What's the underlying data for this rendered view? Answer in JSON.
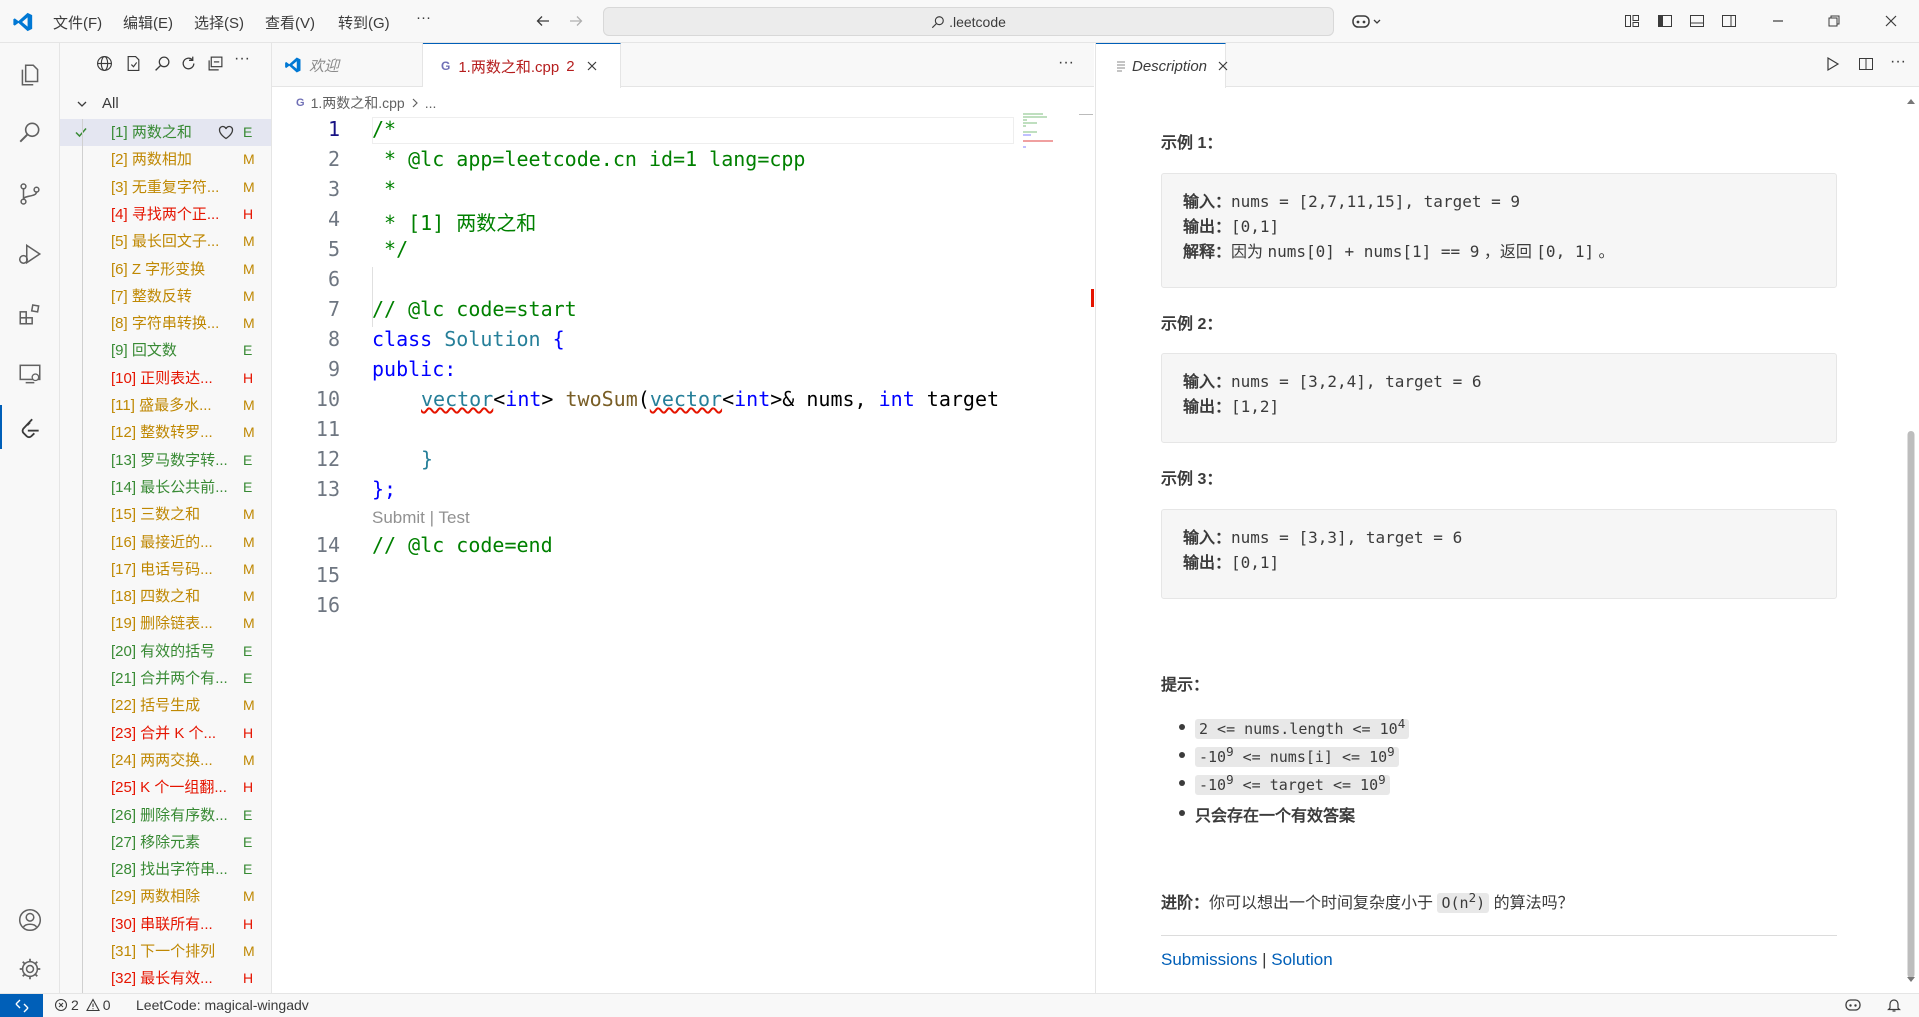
{
  "menu": [
    "文件(F)",
    "编辑(E)",
    "选择(S)",
    "查看(V)",
    "转到(G)",
    "···"
  ],
  "search": {
    "text": ".leetcode"
  },
  "sidebar": {
    "root": "All",
    "problems": [
      {
        "title": "[1] 两数之和",
        "diff": "E",
        "color": "E"
      },
      {
        "title": "[2] 两数相加",
        "diff": "M",
        "color": "M"
      },
      {
        "title": "[3] 无重复字符...",
        "diff": "M",
        "color": "M"
      },
      {
        "title": "[4] 寻找两个正...",
        "diff": "H",
        "color": "H"
      },
      {
        "title": "[5] 最长回文子...",
        "diff": "M",
        "color": "M"
      },
      {
        "title": "[6] Z 字形变换",
        "diff": "M",
        "color": "M"
      },
      {
        "title": "[7] 整数反转",
        "diff": "M",
        "color": "M"
      },
      {
        "title": "[8] 字符串转换...",
        "diff": "M",
        "color": "M"
      },
      {
        "title": "[9] 回文数",
        "diff": "E",
        "color": "E"
      },
      {
        "title": "[10] 正则表达...",
        "diff": "H",
        "color": "H"
      },
      {
        "title": "[11] 盛最多水...",
        "diff": "M",
        "color": "M"
      },
      {
        "title": "[12] 整数转罗...",
        "diff": "M",
        "color": "M"
      },
      {
        "title": "[13] 罗马数字转...",
        "diff": "E",
        "color": "E"
      },
      {
        "title": "[14] 最长公共前...",
        "diff": "E",
        "color": "E"
      },
      {
        "title": "[15] 三数之和",
        "diff": "M",
        "color": "M"
      },
      {
        "title": "[16] 最接近的...",
        "diff": "M",
        "color": "M"
      },
      {
        "title": "[17] 电话号码...",
        "diff": "M",
        "color": "M"
      },
      {
        "title": "[18] 四数之和",
        "diff": "M",
        "color": "M"
      },
      {
        "title": "[19] 删除链表...",
        "diff": "M",
        "color": "M"
      },
      {
        "title": "[20] 有效的括号",
        "diff": "E",
        "color": "E"
      },
      {
        "title": "[21] 合并两个有...",
        "diff": "E",
        "color": "E"
      },
      {
        "title": "[22] 括号生成",
        "diff": "M",
        "color": "M"
      },
      {
        "title": "[23] 合并 K 个...",
        "diff": "H",
        "color": "H"
      },
      {
        "title": "[24] 两两交换...",
        "diff": "M",
        "color": "M"
      },
      {
        "title": "[25] K 个一组翻...",
        "diff": "H",
        "color": "H"
      },
      {
        "title": "[26] 删除有序数...",
        "diff": "E",
        "color": "E"
      },
      {
        "title": "[27] 移除元素",
        "diff": "E",
        "color": "E"
      },
      {
        "title": "[28] 找出字符串...",
        "diff": "E",
        "color": "E"
      },
      {
        "title": "[29] 两数相除",
        "diff": "M",
        "color": "M"
      },
      {
        "title": "[30] 串联所有...",
        "diff": "H",
        "color": "H"
      },
      {
        "title": "[31] 下一个排列",
        "diff": "M",
        "color": "M"
      },
      {
        "title": "[32] 最长有效...",
        "diff": "H",
        "color": "H"
      }
    ]
  },
  "tabs": {
    "welcome": "欢迎",
    "file": "1.两数之和.cpp",
    "file_errors": "2",
    "description": "Description"
  },
  "breadcrumb": {
    "file": "1.两数之和.cpp",
    "more": "..."
  },
  "code": {
    "line_numbers": [
      "1",
      "2",
      "3",
      "4",
      "5",
      "6",
      "7",
      "8",
      "9",
      "10",
      "11",
      "12",
      "13",
      "14",
      "15",
      "16"
    ],
    "l1": "/*",
    "l2": " * @lc app=leetcode.cn id=1 lang=cpp",
    "l3": " *",
    "l4": " * [1] 两数之和",
    "l5": " */",
    "l7": "// @lc code=start",
    "l8a": "class ",
    "l8b": "Solution",
    "l8c": " {",
    "l9": "public:",
    "l10a": "vector",
    "l10b": "<",
    "l10c": "int",
    "l10d": "> ",
    "l10e": "twoSum",
    "l10f": "(",
    "l10g": "vector",
    "l10h": "<",
    "l10i": "int",
    "l10j": ">& nums, ",
    "l10k": "int",
    "l10l": " target",
    "l12": "}",
    "l13": "};",
    "codelens_submit": "Submit",
    "codelens_sep": " | ",
    "codelens_test": "Test",
    "l14": "// @lc code=end"
  },
  "description": {
    "ex1_title": "示例 1：",
    "ex1_in_label": "输入：",
    "ex1_in": "nums = [2,7,11,15], target = 9",
    "ex1_out_label": "输出：",
    "ex1_out": "[0,1]",
    "ex1_exp_label": "解释：",
    "ex1_exp_a": "因为 ",
    "ex1_exp_b": "nums[0] + nums[1] == 9",
    "ex1_exp_c": " ，返回 ",
    "ex1_exp_d": "[0, 1]",
    "ex1_exp_e": " 。",
    "ex2_title": "示例 2：",
    "ex2_in_label": "输入：",
    "ex2_in": "nums = [3,2,4], target = 6",
    "ex2_out_label": "输出：",
    "ex2_out": "[1,2]",
    "ex3_title": "示例 3：",
    "ex3_in_label": "输入：",
    "ex3_in": "nums = [3,3], target = 6",
    "ex3_out_label": "输出：",
    "ex3_out": "[0,1]",
    "hint_title": "提示：",
    "h1a": "2 <= nums.length <= 10",
    "h1sup": "4",
    "h2a": "-10",
    "h2sup1": "9",
    "h2b": " <= nums[i] <= 10",
    "h2sup2": "9",
    "h3a": "-10",
    "h3sup1": "9",
    "h3b": " <= target <= 10",
    "h3sup2": "9",
    "h4": "只会存在一个有效答案",
    "adv_label": "进阶：",
    "adv_a": "你可以想出一个时间复杂度小于 ",
    "adv_code": "O(n",
    "adv_sup": "2",
    "adv_code2": ")",
    "adv_b": " 的算法吗？",
    "link_submissions": "Submissions",
    "link_sep": " | ",
    "link_solution": "Solution"
  },
  "status": {
    "errors": "2",
    "warnings": "0",
    "leetcode": "LeetCode: magical-wingadv"
  },
  "colors": {
    "accent": "#005fb8",
    "easy": "#388a34",
    "medium": "#bf8803",
    "hard": "#e51400"
  }
}
